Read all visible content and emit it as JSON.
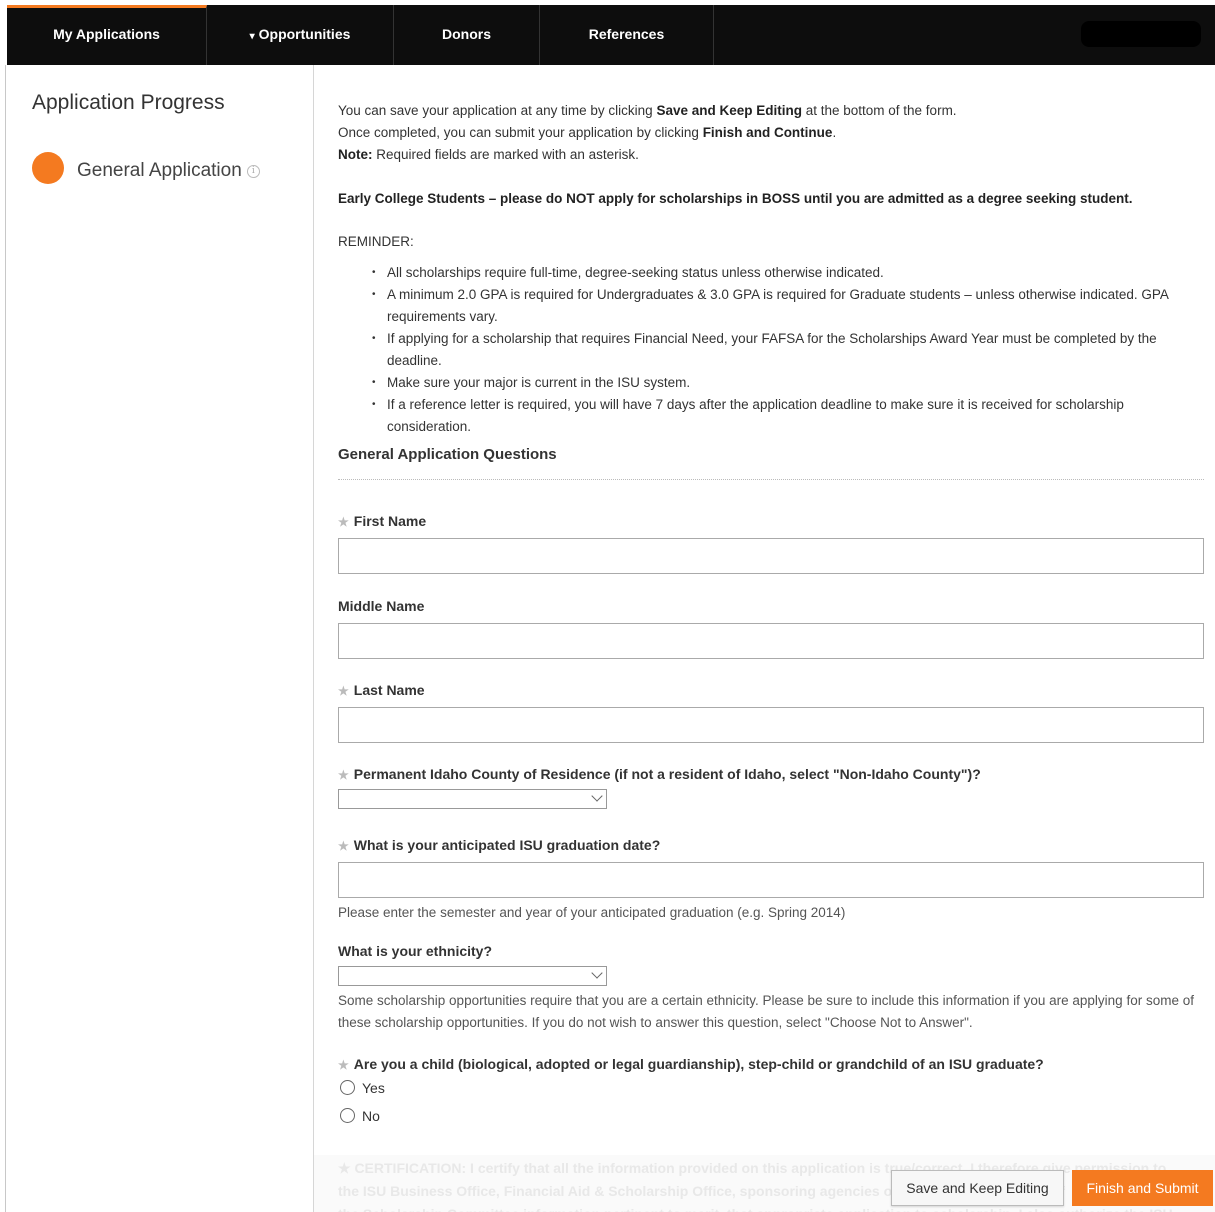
{
  "colors": {
    "accent": "#f47a20",
    "nav_bg": "#0d0d0d"
  },
  "nav": {
    "items": [
      {
        "label": "My Applications"
      },
      {
        "label": "Opportunities",
        "caret": "▾"
      },
      {
        "label": "Donors"
      },
      {
        "label": "References"
      }
    ]
  },
  "sidebar": {
    "title": "Application Progress",
    "step_label": "General Application",
    "info_icon": "info-icon"
  },
  "intro": {
    "line1_pre": "You can save your application at any time by clicking ",
    "line1_bold": "Save and Keep Editing",
    "line1_post": " at the bottom of the form.",
    "line2_pre": "Once completed, you can submit your application by clicking ",
    "line2_bold": "Finish and Continue",
    "line2_post": ".",
    "note_bold": "Note:",
    "note_text": " Required fields are marked with an asterisk."
  },
  "early_college": "Early College Students – please do NOT apply for scholarships in BOSS until you are admitted as a degree seeking student.",
  "reminder": {
    "title": "REMINDER:",
    "items": [
      "All scholarships require full-time, degree-seeking status unless otherwise indicated.",
      "A minimum 2.0 GPA is required for Undergraduates & 3.0 GPA is required for Graduate students – unless otherwise indicated. GPA requirements vary.",
      "If applying for a scholarship that requires Financial Need, your FAFSA for the Scholarships Award Year must be completed by the deadline.",
      "Make sure your major is current in the ISU system.",
      "If a reference letter is required, you will have 7 days after the application deadline to make sure it is received for scholarship consideration."
    ]
  },
  "section_title": "General Application Questions",
  "required_marker": "★",
  "fields": {
    "first_name": {
      "label": "First Name",
      "value": ""
    },
    "middle_name": {
      "label": "Middle Name",
      "value": ""
    },
    "last_name": {
      "label": "Last Name",
      "value": ""
    },
    "county": {
      "label": "Permanent Idaho County of Residence (if not a resident of Idaho, select \"Non-Idaho County\")?",
      "selected": ""
    },
    "grad_date": {
      "label": "What is your anticipated ISU graduation date?",
      "value": "",
      "help": "Please enter the semester and year of your anticipated graduation (e.g. Spring 2014)"
    },
    "ethnicity": {
      "label": "What is your ethnicity?",
      "selected": "",
      "help": "Some scholarship opportunities require that you are a certain ethnicity. Please be sure to include this information if you are applying for some of these scholarship opportunities. If you do not wish to answer this question, select \"Choose Not to Answer\"."
    },
    "isu_child": {
      "label": "Are you a child (biological, adopted or legal guardianship), step-child or grandchild of an ISU graduate?",
      "options": [
        "Yes",
        "No"
      ]
    }
  },
  "certification": {
    "line1": "★ CERTIFICATION: I certify that all the information provided on this application is true/correct. I therefore give permission to",
    "line2": "the ISU Business Office, Financial Aid & Scholarship Office, sponsoring agencies or donors, and members of",
    "line3": "the Scholarship Committee information pertinent to merit, that appropriate application to scholarship. I also authorize the ISU"
  },
  "buttons": {
    "save": "Save and Keep Editing",
    "finish": "Finish and Submit"
  }
}
